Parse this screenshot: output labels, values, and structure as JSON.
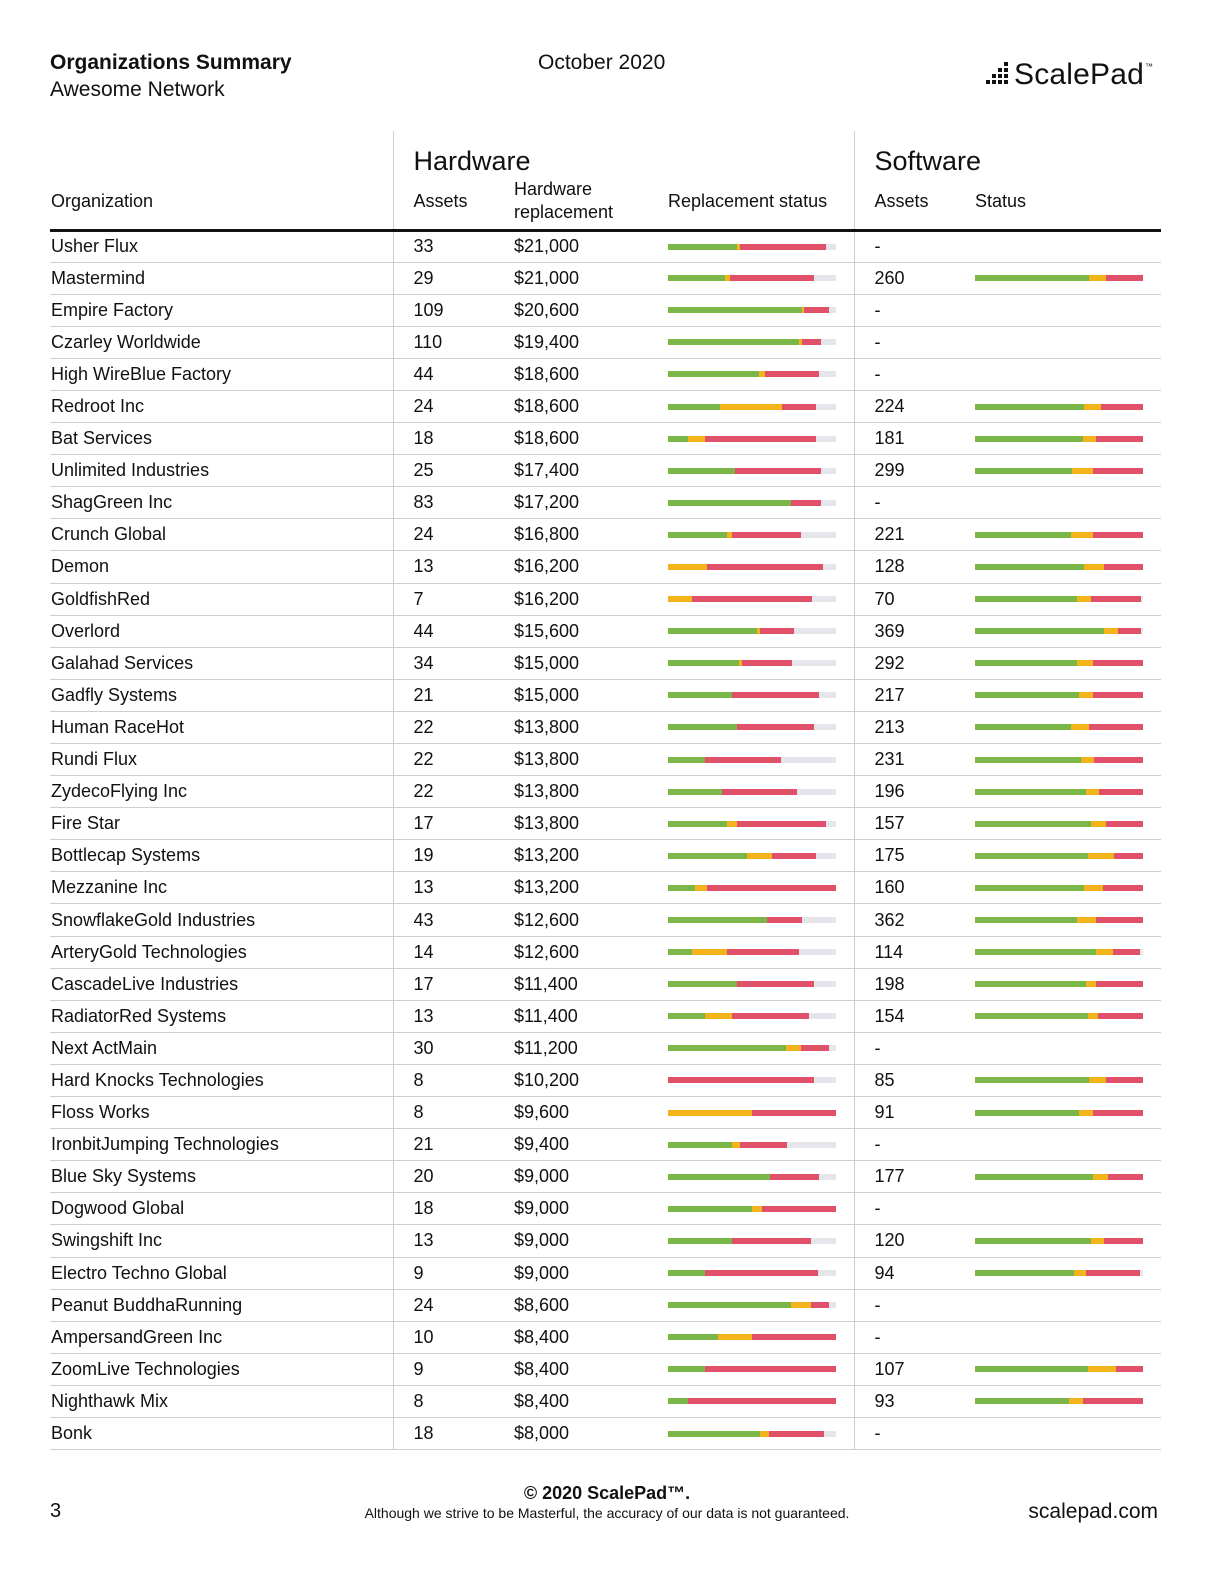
{
  "header": {
    "title": "Organizations Summary",
    "subtitle": "Awesome Network",
    "date": "October 2020",
    "logo_text": "ScalePad",
    "logo_tm": "™"
  },
  "groups": {
    "hardware": "Hardware",
    "software": "Software"
  },
  "columns": {
    "organization": "Organization",
    "hw_assets": "Assets",
    "hw_replacement": "Hardware replacement",
    "replacement_status": "Replacement status",
    "sw_assets": "Assets",
    "sw_status": "Status"
  },
  "rows": [
    {
      "org": "Usher Flux",
      "hw": "33",
      "cost": "$21,000",
      "hwbar": [
        41,
        2,
        51
      ],
      "sw": "-",
      "swbar": null
    },
    {
      "org": "Mastermind",
      "hw": "29",
      "cost": "$21,000",
      "hwbar": [
        34,
        3,
        50
      ],
      "sw": "260",
      "swbar": [
        68,
        10,
        22
      ]
    },
    {
      "org": "Empire Factory",
      "hw": "109",
      "cost": "$20,600",
      "hwbar": [
        80,
        1,
        15
      ],
      "sw": "-",
      "swbar": null
    },
    {
      "org": "Czarley Worldwide",
      "hw": "110",
      "cost": "$19,400",
      "hwbar": [
        78,
        2,
        11
      ],
      "sw": "-",
      "swbar": null
    },
    {
      "org": "High WireBlue Factory",
      "hw": "44",
      "cost": "$18,600",
      "hwbar": [
        54,
        4,
        32
      ],
      "sw": "-",
      "swbar": null
    },
    {
      "org": "Redroot Inc",
      "hw": "24",
      "cost": "$18,600",
      "hwbar": [
        31,
        37,
        20
      ],
      "sw": "224",
      "swbar": [
        65,
        10,
        25
      ]
    },
    {
      "org": "Bat Services",
      "hw": "18",
      "cost": "$18,600",
      "hwbar": [
        12,
        10,
        66
      ],
      "sw": "181",
      "swbar": [
        64,
        8,
        28
      ]
    },
    {
      "org": "Unlimited Industries",
      "hw": "25",
      "cost": "$17,400",
      "hwbar": [
        40,
        0,
        51
      ],
      "sw": "299",
      "swbar": [
        58,
        12,
        30
      ]
    },
    {
      "org": "ShagGreen Inc",
      "hw": "83",
      "cost": "$17,200",
      "hwbar": [
        73,
        0,
        18
      ],
      "sw": "-",
      "swbar": null
    },
    {
      "org": "Crunch Global",
      "hw": "24",
      "cost": "$16,800",
      "hwbar": [
        35,
        3,
        41
      ],
      "sw": "221",
      "swbar": [
        57,
        13,
        30
      ]
    },
    {
      "org": "Demon",
      "hw": "13",
      "cost": "$16,200",
      "hwbar": [
        0,
        23,
        69
      ],
      "sw": "128",
      "swbar": [
        65,
        12,
        23
      ]
    },
    {
      "org": "GoldfishRed",
      "hw": "7",
      "cost": "$16,200",
      "hwbar": [
        0,
        14,
        72
      ],
      "sw": "70",
      "swbar": [
        61,
        8,
        30
      ]
    },
    {
      "org": "Overlord",
      "hw": "44",
      "cost": "$15,600",
      "hwbar": [
        53,
        2,
        20
      ],
      "sw": "369",
      "swbar": [
        77,
        8,
        14
      ]
    },
    {
      "org": "Galahad Services",
      "hw": "34",
      "cost": "$15,000",
      "hwbar": [
        42,
        2,
        30
      ],
      "sw": "292",
      "swbar": [
        61,
        9,
        30
      ]
    },
    {
      "org": "Gadfly Systems",
      "hw": "21",
      "cost": "$15,000",
      "hwbar": [
        38,
        0,
        52
      ],
      "sw": "217",
      "swbar": [
        62,
        8,
        30
      ]
    },
    {
      "org": "Human RaceHot",
      "hw": "22",
      "cost": "$13,800",
      "hwbar": [
        41,
        0,
        46
      ],
      "sw": "213",
      "swbar": [
        57,
        11,
        32
      ]
    },
    {
      "org": "Rundi Flux",
      "hw": "22",
      "cost": "$13,800",
      "hwbar": [
        22,
        0,
        45
      ],
      "sw": "231",
      "swbar": [
        63,
        8,
        29
      ]
    },
    {
      "org": "ZydecoFlying Inc",
      "hw": "22",
      "cost": "$13,800",
      "hwbar": [
        32,
        0,
        45
      ],
      "sw": "196",
      "swbar": [
        66,
        8,
        26
      ]
    },
    {
      "org": "Fire Star",
      "hw": "17",
      "cost": "$13,800",
      "hwbar": [
        35,
        6,
        53
      ],
      "sw": "157",
      "swbar": [
        69,
        9,
        22
      ]
    },
    {
      "org": "Bottlecap Systems",
      "hw": "19",
      "cost": "$13,200",
      "hwbar": [
        47,
        15,
        26
      ],
      "sw": "175",
      "swbar": [
        67,
        16,
        17
      ]
    },
    {
      "org": "Mezzanine Inc",
      "hw": "13",
      "cost": "$13,200",
      "hwbar": [
        16,
        7,
        77
      ],
      "sw": "160",
      "swbar": [
        65,
        11,
        24
      ]
    },
    {
      "org": "SnowflakeGold Industries",
      "hw": "43",
      "cost": "$12,600",
      "hwbar": [
        59,
        0,
        21
      ],
      "sw": "362",
      "swbar": [
        61,
        11,
        28
      ]
    },
    {
      "org": "ArteryGold Technologies",
      "hw": "14",
      "cost": "$12,600",
      "hwbar": [
        14,
        21,
        43
      ],
      "sw": "114",
      "swbar": [
        72,
        10,
        16
      ]
    },
    {
      "org": "CascadeLive Industries",
      "hw": "17",
      "cost": "$11,400",
      "hwbar": [
        41,
        0,
        46
      ],
      "sw": "198",
      "swbar": [
        66,
        6,
        28
      ]
    },
    {
      "org": "RadiatorRed Systems",
      "hw": "13",
      "cost": "$11,400",
      "hwbar": [
        22,
        16,
        46
      ],
      "sw": "154",
      "swbar": [
        67,
        6,
        27
      ]
    },
    {
      "org": "Next ActMain",
      "hw": "30",
      "cost": "$11,200",
      "hwbar": [
        70,
        9,
        17
      ],
      "sw": "-",
      "swbar": null
    },
    {
      "org": "Hard Knocks Technologies",
      "hw": "8",
      "cost": "$10,200",
      "hwbar": [
        0,
        0,
        87
      ],
      "sw": "85",
      "swbar": [
        68,
        10,
        22
      ]
    },
    {
      "org": "Floss Works",
      "hw": "8",
      "cost": "$9,600",
      "hwbar": [
        0,
        50,
        50
      ],
      "sw": "91",
      "swbar": [
        62,
        8,
        30
      ]
    },
    {
      "org": "IronbitJumping Technologies",
      "hw": "21",
      "cost": "$9,400",
      "hwbar": [
        38,
        5,
        28
      ],
      "sw": "-",
      "swbar": null
    },
    {
      "org": "Blue Sky Systems",
      "hw": "20",
      "cost": "$9,000",
      "hwbar": [
        61,
        0,
        29
      ],
      "sw": "177",
      "swbar": [
        70,
        9,
        21
      ]
    },
    {
      "org": "Dogwood Global",
      "hw": "18",
      "cost": "$9,000",
      "hwbar": [
        50,
        6,
        44
      ],
      "sw": "-",
      "swbar": null
    },
    {
      "org": "Swingshift Inc",
      "hw": "13",
      "cost": "$9,000",
      "hwbar": [
        38,
        0,
        47
      ],
      "sw": "120",
      "swbar": [
        69,
        8,
        23
      ]
    },
    {
      "org": "Electro Techno Global",
      "hw": "9",
      "cost": "$9,000",
      "hwbar": [
        22,
        0,
        67
      ],
      "sw": "94",
      "swbar": [
        59,
        7,
        32
      ]
    },
    {
      "org": "Peanut BuddhaRunning",
      "hw": "24",
      "cost": "$8,600",
      "hwbar": [
        73,
        12,
        11
      ],
      "sw": "-",
      "swbar": null
    },
    {
      "org": "AmpersandGreen Inc",
      "hw": "10",
      "cost": "$8,400",
      "hwbar": [
        30,
        20,
        50
      ],
      "sw": "-",
      "swbar": null
    },
    {
      "org": "ZoomLive Technologies",
      "hw": "9",
      "cost": "$8,400",
      "hwbar": [
        22,
        0,
        78
      ],
      "sw": "107",
      "swbar": [
        67,
        17,
        16
      ]
    },
    {
      "org": "Nighthawk Mix",
      "hw": "8",
      "cost": "$8,400",
      "hwbar": [
        12,
        0,
        88
      ],
      "sw": "93",
      "swbar": [
        56,
        8,
        36
      ]
    },
    {
      "org": "Bonk",
      "hw": "18",
      "cost": "$8,000",
      "hwbar": [
        55,
        5,
        33
      ],
      "sw": "-",
      "swbar": null
    }
  ],
  "colors": {
    "good": "#7ab648",
    "warn": "#f3b41b",
    "bad": "#e05068",
    "empty": "#e5e5ec"
  },
  "footer": {
    "page": "3",
    "copyright": "© 2020 ScalePad™.",
    "disclaimer": "Although we strive to be Masterful, the accuracy of our data is not guaranteed.",
    "site": "scalepad.com"
  }
}
